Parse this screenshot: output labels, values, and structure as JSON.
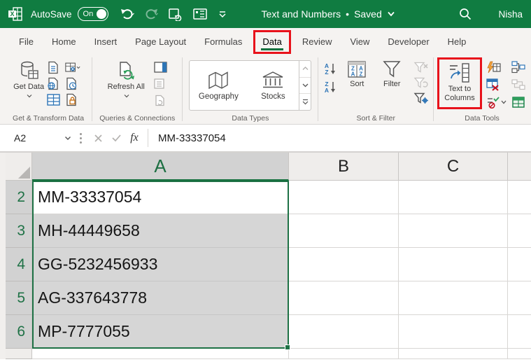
{
  "titlebar": {
    "autosave_label": "AutoSave",
    "autosave_state": "On",
    "doc_title": "Text and Numbers",
    "separator": "•",
    "doc_status": "Saved",
    "user_name": "Nisha"
  },
  "tabs": [
    {
      "label": "File"
    },
    {
      "label": "Home"
    },
    {
      "label": "Insert"
    },
    {
      "label": "Page Layout"
    },
    {
      "label": "Formulas"
    },
    {
      "label": "Data",
      "active": true,
      "highlighted": true
    },
    {
      "label": "Review"
    },
    {
      "label": "View"
    },
    {
      "label": "Developer"
    },
    {
      "label": "Help"
    }
  ],
  "ribbon": {
    "get_transform": {
      "big_label": "Get Data",
      "group_label": "Get & Transform Data"
    },
    "queries": {
      "big_label": "Refresh All",
      "group_label": "Queries & Connections"
    },
    "data_types": {
      "items": [
        {
          "label": "Geography"
        },
        {
          "label": "Stocks"
        }
      ],
      "group_label": "Data Types"
    },
    "sort_filter": {
      "sort_label": "Sort",
      "filter_label": "Filter",
      "group_label": "Sort & Filter"
    },
    "data_tools": {
      "big_label": "Text to Columns",
      "highlighted": true,
      "group_label": "Data Tools"
    }
  },
  "formula_bar": {
    "name_box_value": "A2",
    "fx_label": "fx",
    "formula_value": "MM-33337054"
  },
  "grid": {
    "columns": [
      {
        "label": "A",
        "selected": true
      },
      {
        "label": "B"
      },
      {
        "label": "C"
      }
    ],
    "rows": [
      {
        "number": "2",
        "value": "MM-33337054",
        "active": true
      },
      {
        "number": "3",
        "value": "MH-44449658"
      },
      {
        "number": "4",
        "value": "GG-5232456933"
      },
      {
        "number": "5",
        "value": "AG-337643778"
      },
      {
        "number": "6",
        "value": "MP-7777055"
      }
    ],
    "selected_range": "A2:A6"
  },
  "colors": {
    "excel_green": "#107C41",
    "highlight_red": "#E8121B",
    "selection_border_green": "#1E7145",
    "selected_fill": "#D6D6D6"
  }
}
